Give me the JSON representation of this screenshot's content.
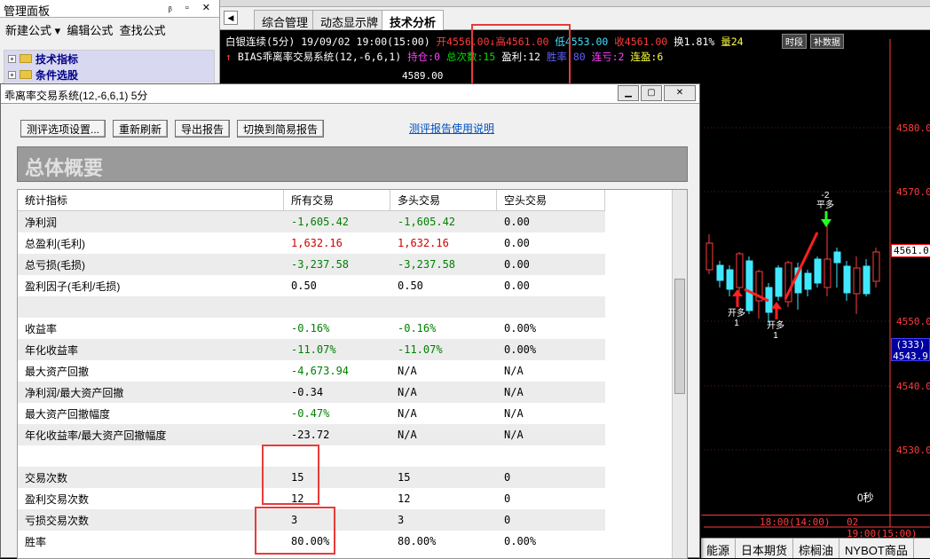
{
  "mgmt": {
    "title": "管理面板",
    "controls": "ᵦ ▫ ✕",
    "toolbar": [
      "新建公式 ▾",
      "编辑公式",
      "查找公式"
    ],
    "tree": [
      "技术指标",
      "条件选股"
    ]
  },
  "tabs": {
    "nav": "◀",
    "items": [
      "综合管理",
      "动态显示牌",
      "技术分析"
    ]
  },
  "chart": {
    "line1": {
      "symbol": "白银连续(5分)",
      "datetime": "19/09/02 19:00(15:00)",
      "open": "开4556.00",
      "high": "↓高4561.00",
      "low": "低4553.00",
      "close": "收4561.00",
      "turnover": "换1.81%",
      "amount": "量24",
      "btn1": "时段",
      "btn2": "补数据"
    },
    "line2": {
      "arrow": "↑",
      "name": "BIAS乖离率交易系统(12,-6,6,1)",
      "pos": "持仓:0",
      "trades": "总次数:15",
      "wins": "盈利:12",
      "rate": "胜率:80",
      "lossstreak": "连亏:2",
      "winstreak": "连盈:6"
    },
    "label_top": "4589.00",
    "price_ticks": [
      "4580.0",
      "4570.0",
      "4561.0",
      "4550.0",
      "4540.0",
      "4530.0"
    ],
    "box_values": [
      "(333)",
      "4543.9"
    ],
    "seconds": "0秒",
    "markers": [
      {
        "text": "开多",
        "sub": "1"
      },
      {
        "text": "开多",
        "sub": "1"
      },
      {
        "text": "-2",
        "sub": "平多"
      }
    ],
    "time_labels": [
      "18:00(14:00)",
      "02 19:00(15:00)"
    ]
  },
  "bottom_tabs": [
    "能源",
    "日本期货",
    "棕榈油",
    "NYBOT商品"
  ],
  "dialog": {
    "title": "乖离率交易系统(12,-6,6,1) 5分",
    "buttons": [
      "测评选项设置...",
      "重新刷新",
      "导出报告",
      "切换到简易报告"
    ],
    "link": "测评报告使用说明",
    "header": "总体概要",
    "columns": [
      "统计指标",
      "所有交易",
      "多头交易",
      "空头交易"
    ],
    "rows": [
      {
        "label": "净利润",
        "all": "-1,605.42",
        "long": "-1,605.42",
        "short": "0.00",
        "cls": "neg"
      },
      {
        "label": "总盈利(毛利)",
        "all": "1,632.16",
        "long": "1,632.16",
        "short": "0.00",
        "cls": "pos"
      },
      {
        "label": "总亏损(毛损)",
        "all": "-3,237.58",
        "long": "-3,237.58",
        "short": "0.00",
        "cls": "neg"
      },
      {
        "label": "盈利因子(毛利/毛损)",
        "all": "0.50",
        "long": "0.50",
        "short": "0.00",
        "cls": ""
      },
      {
        "label": "",
        "all": "",
        "long": "",
        "short": "",
        "cls": ""
      },
      {
        "label": "收益率",
        "all": "-0.16%",
        "long": "-0.16%",
        "short": "0.00%",
        "cls": "neg"
      },
      {
        "label": "年化收益率",
        "all": "-11.07%",
        "long": "-11.07%",
        "short": "0.00%",
        "cls": "neg"
      },
      {
        "label": "最大资产回撤",
        "all": "-4,673.94",
        "long": "N/A",
        "short": "N/A",
        "cls": "neg1"
      },
      {
        "label": "净利润/最大资产回撤",
        "all": "-0.34",
        "long": "N/A",
        "short": "N/A",
        "cls": ""
      },
      {
        "label": "最大资产回撤幅度",
        "all": "-0.47%",
        "long": "N/A",
        "short": "N/A",
        "cls": "neg1"
      },
      {
        "label": "年化收益率/最大资产回撤幅度",
        "all": "-23.72",
        "long": "N/A",
        "short": "N/A",
        "cls": ""
      },
      {
        "label": "",
        "all": "",
        "long": "",
        "short": "",
        "cls": ""
      },
      {
        "label": "交易次数",
        "all": "15",
        "long": "15",
        "short": "0",
        "cls": ""
      },
      {
        "label": "盈利交易次数",
        "all": "12",
        "long": "12",
        "short": "0",
        "cls": ""
      },
      {
        "label": "亏损交易次数",
        "all": "3",
        "long": "3",
        "short": "0",
        "cls": ""
      },
      {
        "label": "胜率",
        "all": "80.00%",
        "long": "80.00%",
        "short": "0.00%",
        "cls": ""
      }
    ]
  },
  "colors": {
    "bull": "#ff3b3b",
    "bear": "#40e8ff",
    "highlight": "#e83a3a"
  }
}
